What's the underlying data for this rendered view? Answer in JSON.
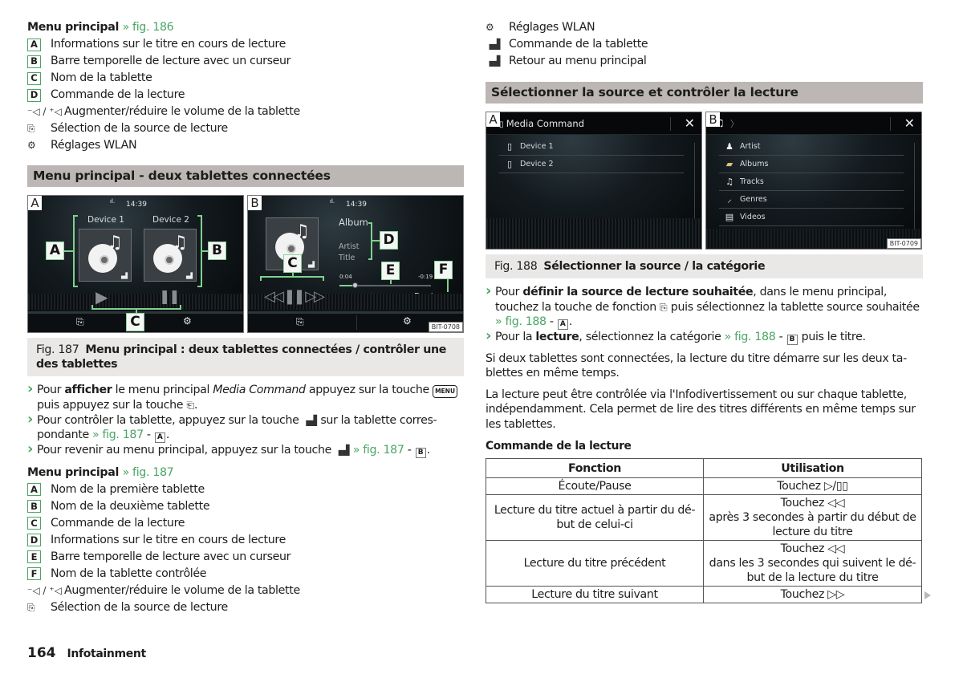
{
  "left": {
    "menu1": {
      "title": "Menu principal",
      "ref": "» fig. 186",
      "items": [
        {
          "key": "A",
          "text": "Informations sur le titre en cours de lecture"
        },
        {
          "key": "B",
          "text": "Barre temporelle de lecture avec un curseur"
        },
        {
          "key": "C",
          "text": "Nom de la tablette"
        },
        {
          "key": "D",
          "text": "Commande de la lecture"
        }
      ],
      "icon_items": [
        {
          "icon": "volume-down-up-icon",
          "glyph": "⁻◁ / ⁺◁",
          "text": "Augmenter/réduire le volume de la tablette"
        },
        {
          "icon": "source-select-icon",
          "glyph": "⎘",
          "text": "Sélection de la source de lecture"
        },
        {
          "icon": "wlan-settings-icon",
          "glyph": "⚙",
          "text": "Réglages WLAN"
        }
      ]
    },
    "section_title": "Menu principal - deux tablettes connectées",
    "figure187": {
      "screenA": {
        "letter": "A",
        "clock": "14:39",
        "signal": "ıl.",
        "devices": [
          "Device 1",
          "Device 2"
        ],
        "callouts": [
          "A",
          "B",
          "C"
        ],
        "play_glyph": "▶",
        "pause_glyph": "❚❚"
      },
      "screenB": {
        "letter": "B",
        "clock": "14:39",
        "signal": "ıl.",
        "album": "Album",
        "artist": "Artist",
        "title": "Title",
        "time_elapsed": "0:04",
        "time_remaining": "-0:19",
        "progress_fraction": 0.17,
        "device": "Device",
        "controls": "◁◁ ❚❚ ▷▷",
        "callouts": [
          "C",
          "D",
          "E",
          "F"
        ],
        "code": "BIT-0708"
      },
      "caption_num": "Fig. 187",
      "caption_title": "Menu principal : deux tablettes connectées / contrôler une des tablettes"
    },
    "bullets": [
      {
        "pre": "Pour ",
        "bold": "afficher",
        "mid": " le menu principal ",
        "italic": "Media Command",
        "post": " appuyez sur la touche ",
        "key": "MENU",
        "post2": " puis appuyez sur la touche ",
        "icon": "⎗",
        "end": "."
      },
      {
        "text1": "Pour contrôler la tablette, appuyez sur la touche ",
        "icon": "▗▟",
        "text2": " sur la tablette corres-pondante ",
        "ref": "» fig. 187",
        "dash": " - ",
        "badge": "A",
        "end": "."
      },
      {
        "text1": "Pour revenir au menu principal, appuyez sur la touche ",
        "icon": "▗▟",
        "text2": " ",
        "ref": "» fig. 187",
        "dash": " - ",
        "badge": "B",
        "end": "."
      }
    ],
    "menu2": {
      "title": "Menu principal",
      "ref": "» fig. 187",
      "items": [
        {
          "key": "A",
          "text": "Nom de la première tablette"
        },
        {
          "key": "B",
          "text": "Nom de la deuxième tablette"
        },
        {
          "key": "C",
          "text": "Commande de la lecture"
        },
        {
          "key": "D",
          "text": "Informations sur le titre en cours de lecture"
        },
        {
          "key": "E",
          "text": "Barre temporelle de lecture avec un curseur"
        },
        {
          "key": "F",
          "text": "Nom de la tablette contrôlée"
        }
      ],
      "icon_items": [
        {
          "icon": "volume-down-up-icon",
          "glyph": "⁻◁ / ⁺◁",
          "text": "Augmenter/réduire le volume de la tablette"
        },
        {
          "icon": "source-select-icon",
          "glyph": "⎘",
          "text": "Sélection de la source de lecture"
        }
      ]
    }
  },
  "right": {
    "icon_items": [
      {
        "icon": "wlan-settings-icon",
        "glyph": "⚙",
        "text": "Réglages WLAN"
      },
      {
        "icon": "tablet-control-icon",
        "glyph": "▗▟",
        "text": "Commande de la tablette"
      },
      {
        "icon": "back-to-main-icon",
        "glyph": "▗▟",
        "text": "Retour au menu principal"
      }
    ],
    "section_title": "Sélectionner la source et contrôler la lecture",
    "figure188": {
      "screenA": {
        "letter": "A",
        "title": "Media Command",
        "close": "✕",
        "rows": [
          "Device 1",
          "Device 2"
        ]
      },
      "screenB": {
        "letter": "B",
        "breadcrumb": "〉",
        "close": "✕",
        "rows": [
          {
            "icon": "artist-icon",
            "glyph": "♟",
            "label": "Artist"
          },
          {
            "icon": "albums-icon",
            "glyph": "▰",
            "label": "Albums"
          },
          {
            "icon": "tracks-icon",
            "glyph": "♫",
            "label": "Tracks"
          },
          {
            "icon": "genres-icon",
            "glyph": "⸝",
            "label": "Genres"
          },
          {
            "icon": "videos-icon",
            "glyph": "▤",
            "label": "Videos"
          }
        ],
        "code": "BIT-0709"
      },
      "caption_num": "Fig. 188",
      "caption_title": "Sélectionner la source / la catégorie"
    },
    "bullets": [
      {
        "pre": "Pour ",
        "bold": "définir la source de lecture souhaitée",
        "mid": ", dans le menu principal, touchez la touche de fonction ",
        "icon": "⎘",
        "post": " puis sélectionnez la tablette source souhaitée ",
        "ref": "» fig. 188",
        "dash": " - ",
        "badge": "A",
        "end": "."
      },
      {
        "pre": "Pour la ",
        "bold": "lecture",
        "mid": ", sélectionnez la catégorie ",
        "ref": "» fig. 188",
        "dash": " - ",
        "badge": "B",
        "end": " puis le titre."
      }
    ],
    "para1": "Si deux tablettes sont connectées, la lecture du titre démarre sur les deux ta-blettes en même temps.",
    "para2": "La lecture peut être contrôlée via l'Infodivertissement ou sur chaque tablette, indépendamment. Cela permet de lire des titres différents en même temps sur les tablettes.",
    "table_title": "Commande de la lecture",
    "table": {
      "headers": [
        "Fonction",
        "Utilisation"
      ],
      "rows": [
        {
          "fn": "Écoute/Pause",
          "use": [
            "Touchez ▷/▯▯"
          ]
        },
        {
          "fn": "Lecture du titre actuel à partir du dé-but de celui-ci",
          "use": [
            "Touchez ◁◁",
            "après 3 secondes à partir du début de lecture du titre"
          ]
        },
        {
          "fn": "Lecture du titre précédent",
          "use": [
            "Touchez ◁◁",
            "dans les 3 secondes qui suivent le dé-but de la lecture du titre"
          ]
        },
        {
          "fn": "Lecture du titre suivant",
          "use": [
            "Touchez ▷▷"
          ]
        }
      ]
    }
  },
  "footer": {
    "page": "164",
    "section": "Infotainment"
  }
}
